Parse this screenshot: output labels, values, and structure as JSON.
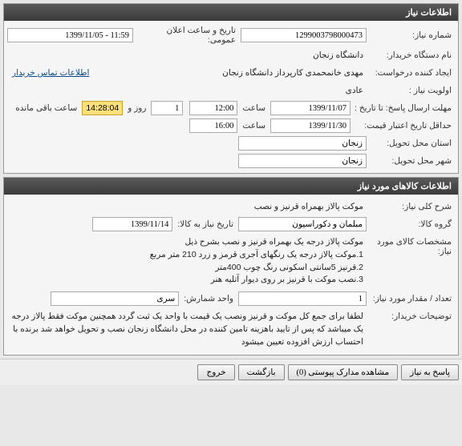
{
  "panel1": {
    "title": "اطلاعات نیاز",
    "need_no_label": "شماره نیاز:",
    "need_no": "1299003798000473",
    "pub_date_label": "تاریخ و ساعت اعلان عمومی:",
    "pub_date": "11:59 - 1399/11/05",
    "buyer_label": "نام دستگاه خریدار:",
    "buyer": "دانشگاه زنجان",
    "creator_label": "ایجاد کننده درخواست:",
    "creator": "مهدی خانمحمدی کارپرداز دانشگاه زنجان",
    "contact_link": "اطلاعات تماس خریدار",
    "priority_label": "اولویت نیاز :",
    "priority": "عادی",
    "deadline_label": "مهلت ارسال پاسخ:  تا تاریخ :",
    "deadline_date": "1399/11/07",
    "time_label": "ساعت",
    "deadline_time": "12:00",
    "days": "1",
    "days_label": "روز و",
    "timer": "14:28:04",
    "remain_label": "ساعت باقی مانده",
    "validity_label": "حداقل تاریخ اعتبار قیمت:",
    "validity_date": "1399/11/30",
    "validity_time": "16:00",
    "province_label": "استان محل تحویل:",
    "province": "زنجان",
    "city_label": "شهر محل تحویل:",
    "city": "زنجان"
  },
  "panel2": {
    "title": "اطلاعات کالاهای مورد نیاز",
    "desc_label": "شرح کلی نیاز:",
    "desc": "موکت پالاز بهمراه قرنیز و نصب",
    "group_label": "گروه کالا:",
    "group": "مبلمان و دکوراسیون",
    "need_date_label": "تاریخ نیاز به کالا:",
    "need_date": "1399/11/14",
    "spec_label": "مشخصات کالای مورد نیاز:",
    "spec_l1": "موکت پالاز درجه یک بهمراه قرنیز و نصب  بشرح ذیل",
    "spec_l2": "1.موکت پالاز درجه یک رنگهای آجری قرمز و زرد 210 متر مربع",
    "spec_l3": "2.قرنیز 5سانتی اسکونی رنگ چوب 400متر",
    "spec_l4": "3.نصب موکت با قرنیز بر روی دیوار آتلیه هنر",
    "qty_label": "تعداد / مقدار مورد نیاز:",
    "qty": "1",
    "unit_label": "واحد شمارش:",
    "unit": "سری",
    "notes_label": "توضیحات خریدار:",
    "notes": "لطفا برای جمع کل موکت و قرنیز ونصب یک قیمت با واحد یک ثبت گردد همچنین موکت فقط پالاز درجه یک میباشد که پس از تایید باهزینه تامین کننده در محل دانشگاه زنجان نصب و تحویل خواهد شد برنده با احتساب ارزش افزوده تعیین میشود"
  },
  "buttons": {
    "reply": "پاسخ به نیاز",
    "view_docs": "مشاهده مدارک پیوستی (0)",
    "return": "بازگشت",
    "exit": "خروج"
  }
}
